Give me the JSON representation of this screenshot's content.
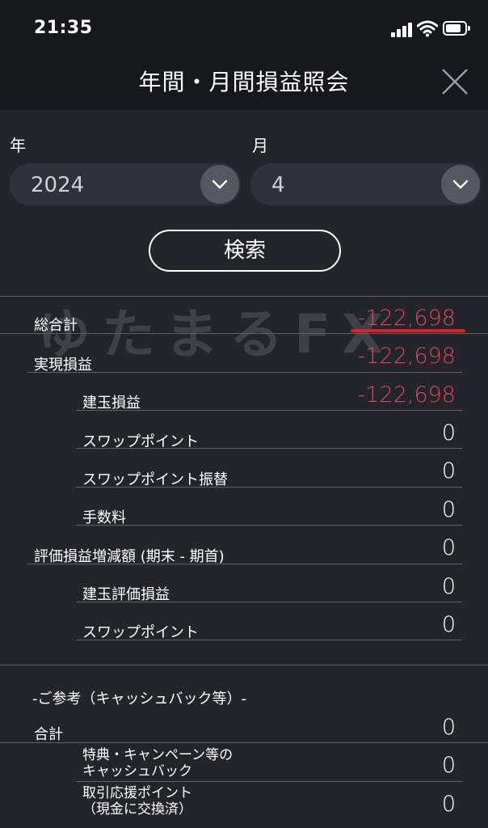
{
  "status_bar": {
    "time": "21:35"
  },
  "header": {
    "title": "年間・月間損益照会"
  },
  "filters": {
    "year_label": "年",
    "year_value": "2024",
    "month_label": "月",
    "month_value": "4"
  },
  "search_button": "検索",
  "watermark": "ゆたまるFX",
  "rows": {
    "total": {
      "label": "総合計",
      "value": "-122,698"
    },
    "realized": {
      "label": "実現損益",
      "value": "-122,698"
    },
    "position_pl": {
      "label": "建玉損益",
      "value": "-122,698"
    },
    "swap_point": {
      "label": "スワップポイント",
      "value": "0"
    },
    "swap_transfer": {
      "label": "スワップポイント振替",
      "value": "0"
    },
    "fee": {
      "label": "手数料",
      "value": "0"
    },
    "valuation_change": {
      "label": "評価損益増減額 (期末 - 期首)",
      "value": "0"
    },
    "position_valuation": {
      "label": "建玉評価損益",
      "value": "0"
    },
    "valuation_swap": {
      "label": "スワップポイント",
      "value": "0"
    }
  },
  "reference": {
    "heading": "-ご参考（キャッシュバック等）-",
    "total": {
      "label": "合計",
      "value": "0"
    },
    "cashback": {
      "label_line1": "特典・キャンペーン等の",
      "label_line2": "キャッシュバック",
      "value": "0"
    },
    "support_points": {
      "label_line1": "取引応援ポイント",
      "label_line2": "（現金に交換済）",
      "value": "0"
    }
  },
  "colors": {
    "background": "#24252b",
    "header_bg": "#17181c",
    "negative": "#d8455f",
    "underline": "#e01e2c"
  }
}
